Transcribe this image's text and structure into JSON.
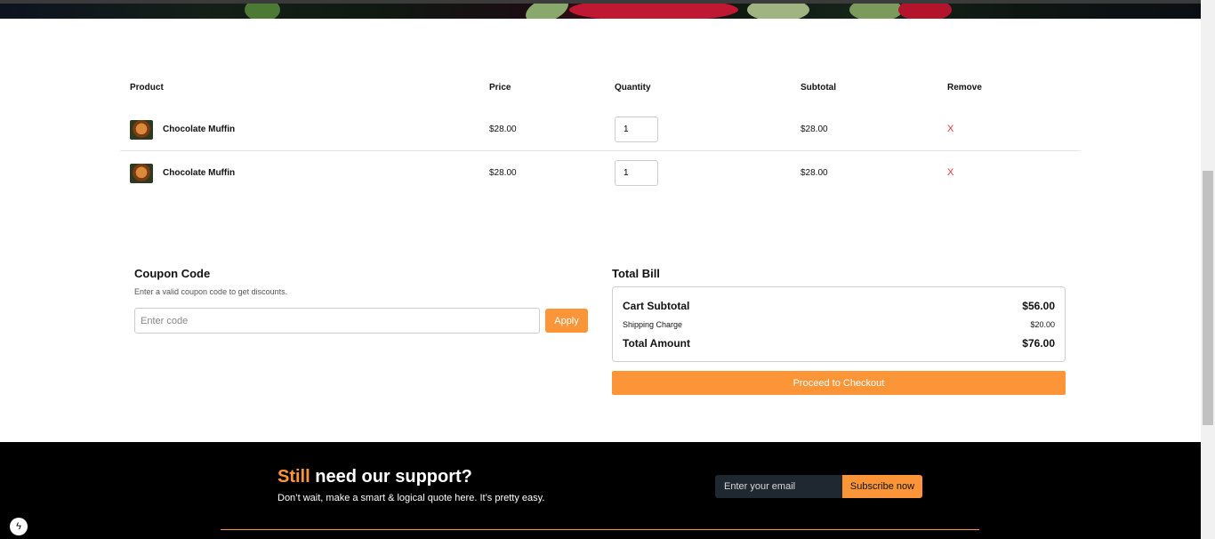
{
  "cart": {
    "headers": {
      "product": "Product",
      "price": "Price",
      "quantity": "Quantity",
      "subtotal": "Subtotal",
      "remove": "Remove"
    },
    "items": [
      {
        "name": "Chocolate Muffin",
        "price": "$28.00",
        "quantity": "1",
        "subtotal": "$28.00",
        "remove": "X"
      },
      {
        "name": "Chocolate Muffin",
        "price": "$28.00",
        "quantity": "1",
        "subtotal": "$28.00",
        "remove": "X"
      }
    ]
  },
  "coupon": {
    "title": "Coupon Code",
    "description": "Enter a valid coupon code to get discounts.",
    "placeholder": "Enter code",
    "apply_label": "Apply"
  },
  "bill": {
    "title": "Total Bill",
    "cart_subtotal_label": "Cart Subtotal",
    "cart_subtotal_value": "$56.00",
    "shipping_label": "Shipping Charge",
    "shipping_value": "$20.00",
    "total_label": "Total Amount",
    "total_value": "$76.00",
    "checkout_label": "Proceed to Checkout"
  },
  "footer": {
    "title_accent": "Still",
    "title_rest": "need our support?",
    "subtitle": "Don’t wait, make a smart & logical quote here. It’s pretty easy.",
    "email_placeholder": "Enter your email",
    "subscribe_label": "Subscribe now"
  },
  "colors": {
    "accent": "#fb9537",
    "remove": "#e8343f",
    "footer_bg": "#000000",
    "input_dark": "#1f2731"
  },
  "icons": {
    "bolt": "lightning-icon",
    "product_thumb": "muffin-thumbnail-icon"
  }
}
